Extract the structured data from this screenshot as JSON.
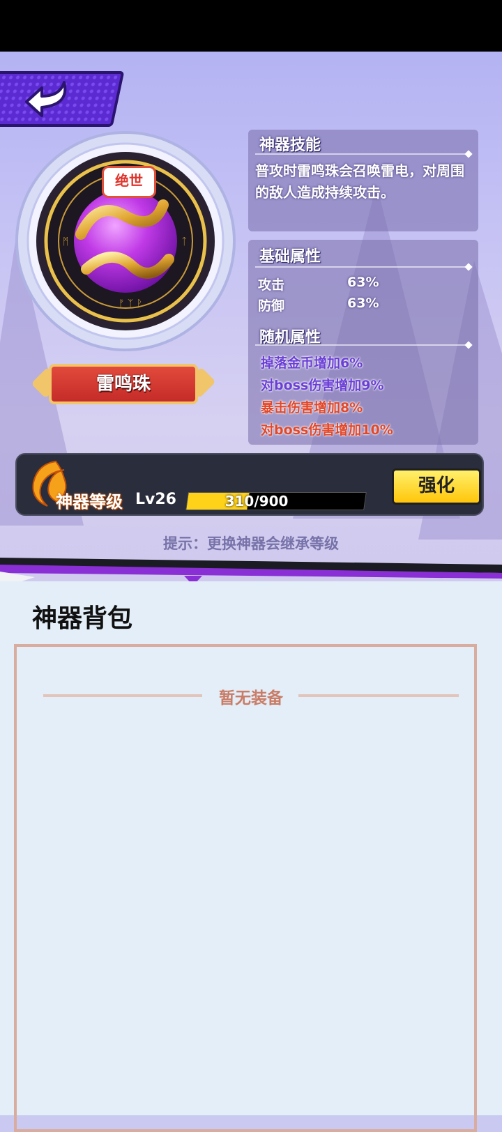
{
  "artifact": {
    "name": "雷鸣珠",
    "rarity": "绝世",
    "icon": "thunder-orb-icon"
  },
  "skill_panel": {
    "title": "神器技能",
    "description": "普攻时雷鸣珠会召唤雷电，对周围的敌人造成持续攻击。"
  },
  "base_stats": {
    "title": "基础属性",
    "items": [
      {
        "label": "攻击",
        "value": "63%"
      },
      {
        "label": "防御",
        "value": "63%"
      }
    ]
  },
  "random_stats": {
    "title": "随机属性",
    "items": [
      {
        "text": "掉落金币增加6%",
        "color": "#6a3fd6"
      },
      {
        "text": "对boss伤害增加9%",
        "color": "#6a3fd6"
      },
      {
        "text": "暴击伤害增加8%",
        "color": "#e2472a"
      },
      {
        "text": "对boss伤害增加10%",
        "color": "#e2472a"
      }
    ]
  },
  "level": {
    "title": "神器等级",
    "level_label": "Lv26",
    "xp_text": "310/900",
    "xp_progress": 0.344,
    "upgrade_label": "强化"
  },
  "hint": "提示：更换神器会继承等级",
  "bag": {
    "title": "神器背包",
    "empty_text": "暂无装备"
  },
  "colors": {
    "accent": "#5b2ad1",
    "button_yellow": "#ffd21a"
  }
}
